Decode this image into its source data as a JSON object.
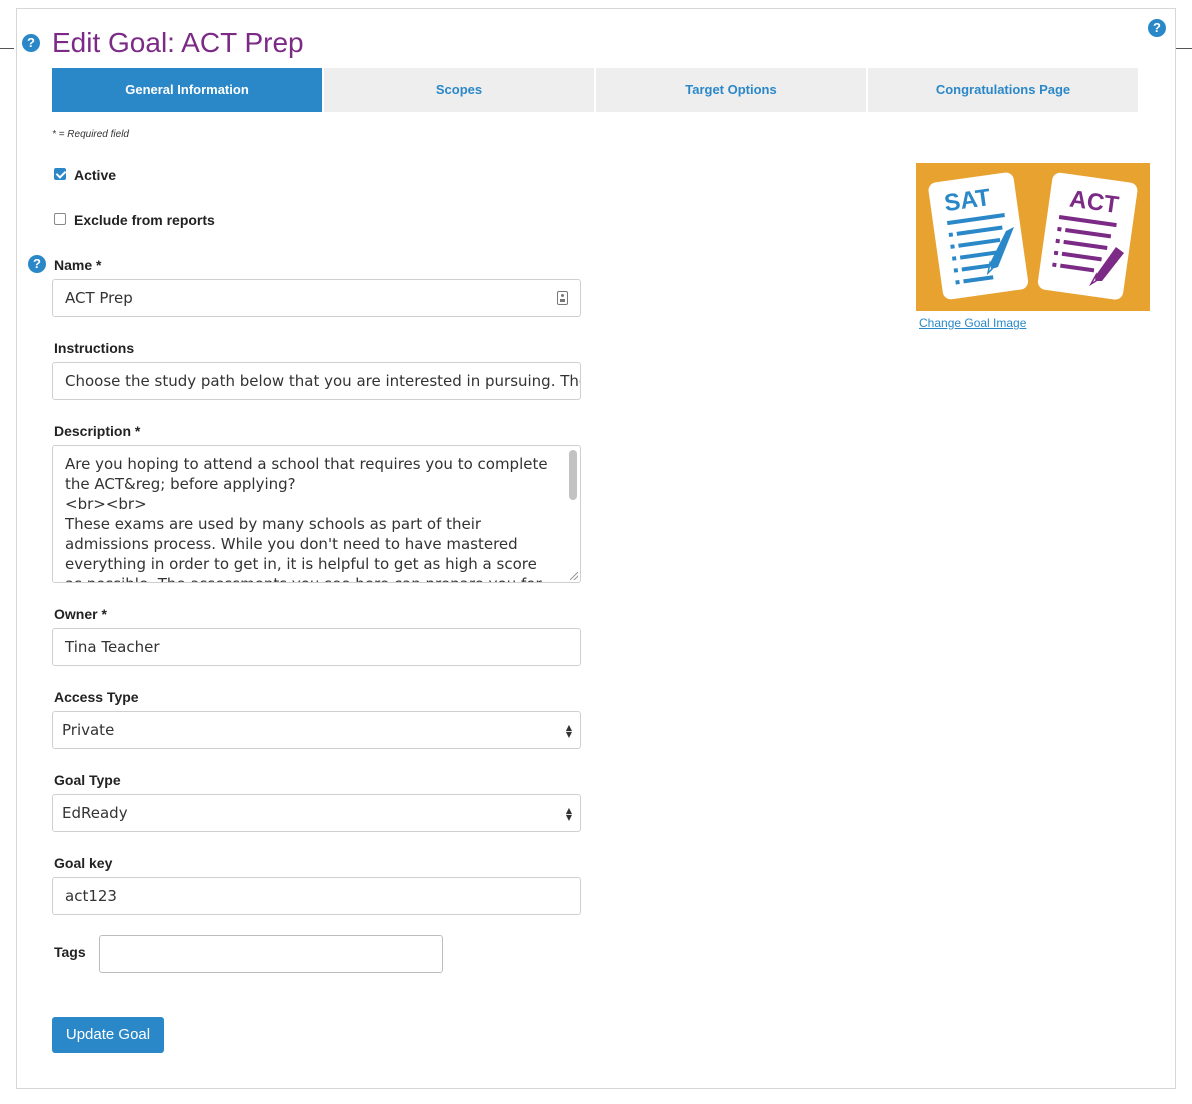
{
  "page": {
    "title": "Edit Goal: ACT Prep"
  },
  "tabs": [
    {
      "label": "General Information",
      "active": true
    },
    {
      "label": "Scopes",
      "active": false
    },
    {
      "label": "Target Options",
      "active": false
    },
    {
      "label": "Congratulations Page",
      "active": false
    }
  ],
  "required_note": "* = Required field",
  "checkboxes": {
    "active": {
      "label": "Active",
      "checked": true
    },
    "exclude": {
      "label": "Exclude from reports",
      "checked": false
    }
  },
  "fields": {
    "name": {
      "label": "Name *",
      "value": "ACT Prep"
    },
    "instructions": {
      "label": "Instructions",
      "value": "Choose the study path below that you are interested in pursuing. The as"
    },
    "description": {
      "label": "Description *",
      "value": "Are you hoping to attend a school that requires you to complete the ACT&reg; before applying?\n<br><br>\nThese exams are used by many schools as part of their admissions process. While you don't need to have mastered everything in order to get in, it is helpful to get as high a score as possible. The assessments you see here can prepare you for either of these exams."
    },
    "owner": {
      "label": "Owner *",
      "value": "Tina Teacher"
    },
    "access_type": {
      "label": "Access Type",
      "value": "Private"
    },
    "goal_type": {
      "label": "Goal Type",
      "value": "EdReady"
    },
    "goal_key": {
      "label": "Goal key",
      "value": "act123"
    },
    "tags": {
      "label": "Tags",
      "value": ""
    }
  },
  "goal_image": {
    "sat_text": "SAT",
    "act_text": "ACT",
    "change_link": "Change Goal Image",
    "colors": {
      "background": "#e8a230",
      "sat": "#2b88c8",
      "act": "#7b2a86"
    }
  },
  "buttons": {
    "update": "Update Goal"
  },
  "help_icon_glyph": "?",
  "colors": {
    "accent": "#2b88c8",
    "title": "#7b2a86",
    "tab_inactive_bg": "#eeeeee"
  }
}
